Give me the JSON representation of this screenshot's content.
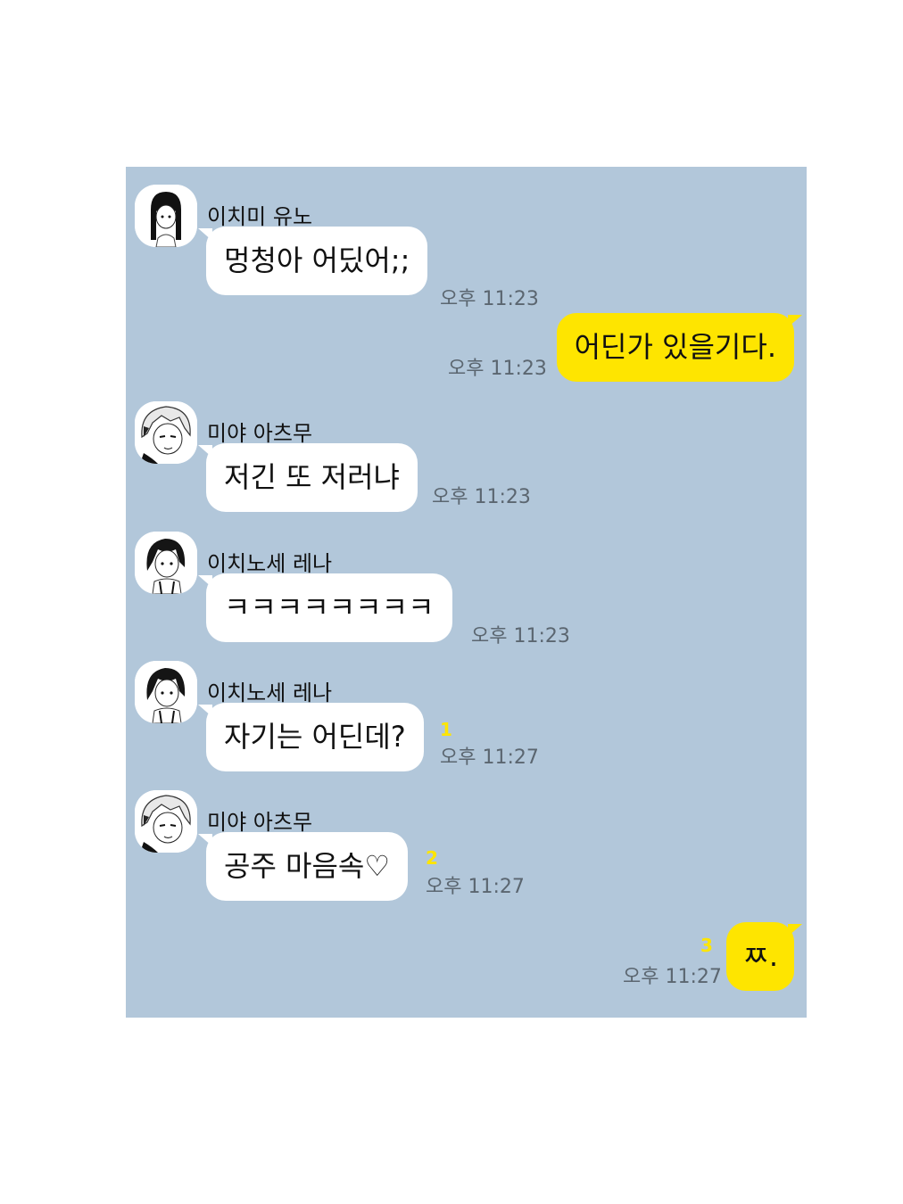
{
  "colors": {
    "chat_background": "#b2c7da",
    "incoming_bubble": "#ffffff",
    "outgoing_bubble": "#fee500",
    "timestamp_text": "#5b6670",
    "unread_count": "#fee500"
  },
  "messages": [
    {
      "direction": "in",
      "sender": "이치미 유노",
      "avatar": "long-black-hair-girl-avatar",
      "text": "멍청아 어딨어;;",
      "time": "오후 11:23",
      "unread": ""
    },
    {
      "direction": "out",
      "sender": "",
      "text": "어딘가 있을기다.",
      "time": "오후 11:23",
      "unread": ""
    },
    {
      "direction": "in",
      "sender": "미야 아츠무",
      "avatar": "blond-boy-avatar",
      "text": "저긴 또 저러냐",
      "time": "오후 11:23",
      "unread": ""
    },
    {
      "direction": "in",
      "sender": "이치노세 레나",
      "avatar": "dark-hair-girl-avatar",
      "text": "ㅋㅋㅋㅋㅋㅋㅋㅋ",
      "time": "오후 11:23",
      "unread": ""
    },
    {
      "direction": "in",
      "sender": "이치노세 레나",
      "avatar": "dark-hair-girl-avatar",
      "text": "자기는 어딘데?",
      "time": "오후 11:27",
      "unread": "1"
    },
    {
      "direction": "in",
      "sender": "미야 아츠무",
      "avatar": "blond-boy-avatar",
      "text": "공주 마음속♡",
      "time": "오후 11:27",
      "unread": "2"
    },
    {
      "direction": "out",
      "sender": "",
      "text": "ㅉ.",
      "time": "오후 11:27",
      "unread": "3"
    }
  ]
}
